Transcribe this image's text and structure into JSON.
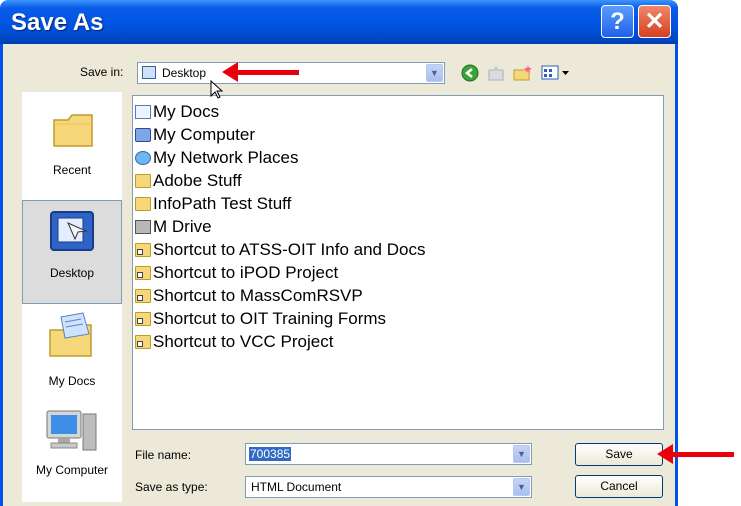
{
  "window": {
    "title": "Save As"
  },
  "titlebar": {
    "help_glyph": "?",
    "close_glyph": "✕"
  },
  "toolbar": {
    "save_in_label": "Save in:",
    "save_in_value": "Desktop"
  },
  "places": [
    "Recent",
    "Desktop",
    "My Docs",
    "My Computer"
  ],
  "files": [
    {
      "name": "My Docs",
      "icon": "documents-icon"
    },
    {
      "name": "My Computer",
      "icon": "computer-icon"
    },
    {
      "name": "My Network Places",
      "icon": "network-icon"
    },
    {
      "name": "Adobe Stuff",
      "icon": "folder-icon"
    },
    {
      "name": "InfoPath Test Stuff",
      "icon": "folder-icon"
    },
    {
      "name": "M Drive",
      "icon": "network-drive-icon"
    },
    {
      "name": "Shortcut to ATSS-OIT Info and Docs",
      "icon": "folder-shortcut-icon"
    },
    {
      "name": "Shortcut to iPOD Project",
      "icon": "folder-shortcut-icon"
    },
    {
      "name": "Shortcut to MassComRSVP",
      "icon": "folder-shortcut-icon"
    },
    {
      "name": "Shortcut to OIT Training Forms",
      "icon": "folder-shortcut-icon"
    },
    {
      "name": "Shortcut to VCC Project",
      "icon": "folder-shortcut-icon"
    }
  ],
  "form": {
    "file_name_label": "File name:",
    "file_name_value": "700385",
    "save_as_type_label": "Save as type:",
    "save_as_type_value": "HTML Document"
  },
  "buttons": {
    "save": "Save",
    "cancel": "Cancel"
  },
  "colors": {
    "titlebar": "#0054e3",
    "dialog_bg": "#ece9d8",
    "annotation_arrow": "#e8000d"
  }
}
